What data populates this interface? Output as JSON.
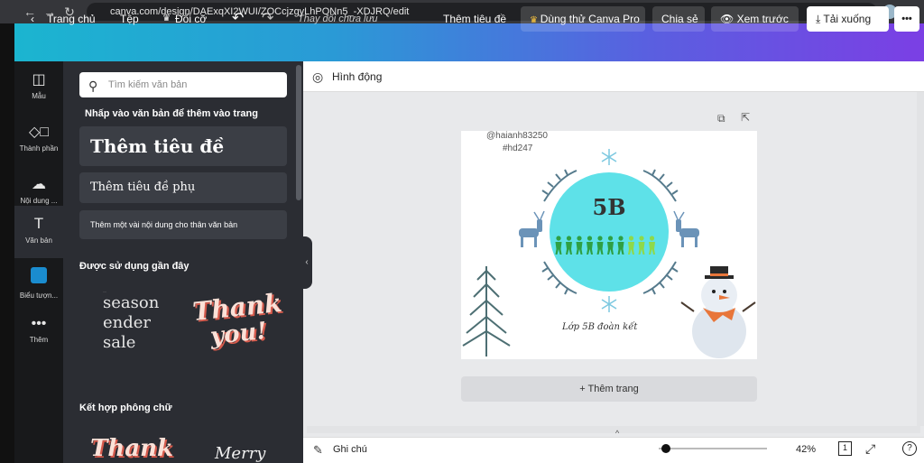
{
  "browser": {
    "url": "canva.com/design/DAExqXI2WUI/ZOCcjzgyLhPONn5_-XDJRQ/edit"
  },
  "toolbar": {
    "home": "Trang chủ",
    "file": "Tệp",
    "resize": "Đổi cỡ",
    "save_status": "Thay đổi chưa lưu",
    "add_title": "Thêm tiêu đề",
    "try_pro": "Dùng thử Canva Pro",
    "share": "Chia sẻ",
    "preview": "Xem trước",
    "download": "Tải xuống",
    "more": "•••"
  },
  "rail": {
    "items": [
      {
        "label": "Mẫu"
      },
      {
        "label": "Thành phần"
      },
      {
        "label": "Nội dung ..."
      },
      {
        "label": "Văn bản"
      },
      {
        "label": "Biểu tượn..."
      },
      {
        "label": "Thêm"
      }
    ]
  },
  "panel": {
    "search_placeholder": "Tìm kiếm văn bản",
    "click_hint": "Nhấp vào văn bản để thêm vào trang",
    "add_heading": "Thêm tiêu đề",
    "add_subheading": "Thêm tiêu đề phụ",
    "add_body": "Thêm một vài nội dung cho thân văn bản",
    "recent_title": "Được sử dụng gần đây",
    "recent_1_line1": "season",
    "recent_1_line2": "ender",
    "recent_1_line3": "sale",
    "recent_2_line1": "Thank",
    "recent_2_line2": "you!",
    "combos_title": "Kết hợp phông chữ",
    "combo_1": "Thank",
    "combo_2": "Merry"
  },
  "workspace": {
    "animate": "Hình động",
    "add_page": "+ Thêm trang",
    "notes": "Ghi chú",
    "zoom": "42%",
    "zoom_level": 0.07,
    "page_count": "1"
  },
  "design": {
    "credit_user": "@haianh83250",
    "credit_tag": "#hd247",
    "class_name": "5B",
    "caption": "Lớp 5B đoàn kết",
    "circle_color": "#5ee1e8",
    "people_dark": "#2ea043",
    "people_light": "#8ed94a"
  }
}
